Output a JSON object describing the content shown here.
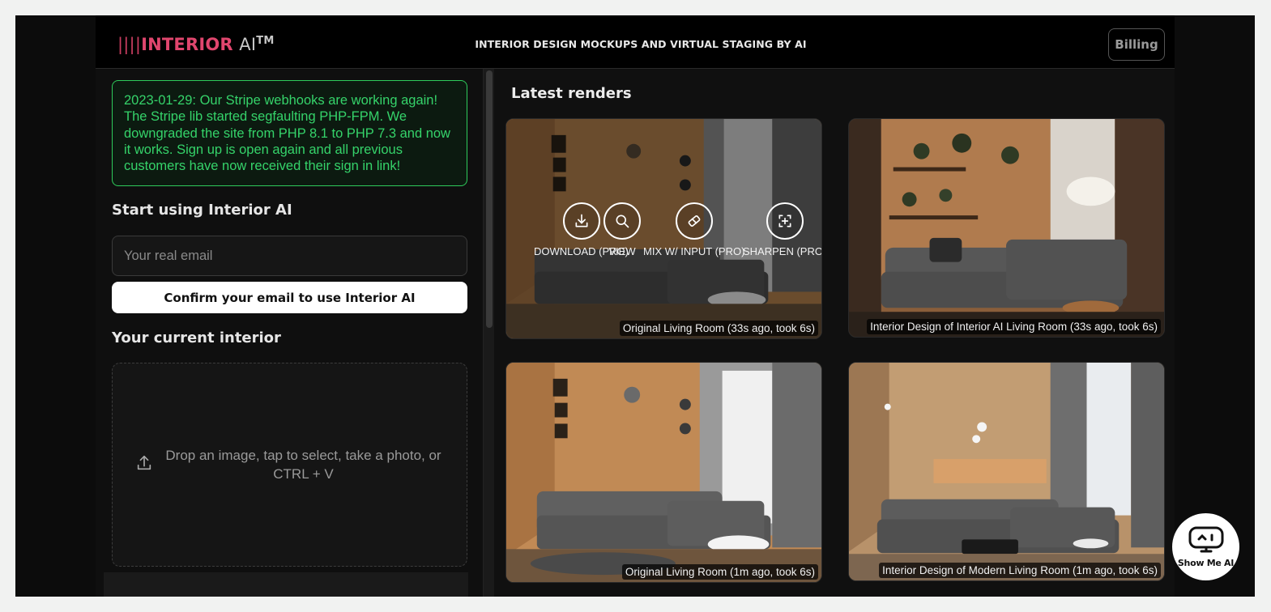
{
  "header": {
    "logo_bars": "||||",
    "logo_name": "INTERIOR",
    "logo_ai": "AI",
    "logo_tm": "TM",
    "tagline": "INTERIOR DESIGN MOCKUPS AND VIRTUAL STAGING BY AI",
    "billing_label": "Billing"
  },
  "sidebar": {
    "notice": "2023-01-29: Our Stripe webhooks are working again! The Stripe lib started segfaulting PHP-FPM. We downgraded the site from PHP 8.1 to PHP 7.3 and now it works. Sign up is open again and all previous customers have now received their sign in link!",
    "start_heading": "Start using Interior AI",
    "email_placeholder": "Your real email",
    "confirm_label": "Confirm your email to use Interior AI",
    "current_heading": "Your current interior",
    "dropzone_text": "Drop an image, tap to select, take a photo, or CTRL + V"
  },
  "main": {
    "latest_heading": "Latest renders",
    "actions": [
      {
        "label": "DOWNLOAD (PRO)",
        "icon": "download-icon"
      },
      {
        "label": "VIEW",
        "icon": "search-icon"
      },
      {
        "label": "MIX W/ INPUT (PRO)",
        "icon": "eraser-icon"
      },
      {
        "label": "SHARPEN (PRO)",
        "icon": "focus-icon"
      }
    ],
    "renders": [
      {
        "caption": "Original Living Room (33s ago, took 6s)"
      },
      {
        "caption": "Interior Design of Interior AI Living Room (33s ago, took 6s)"
      },
      {
        "caption": "Original Living Room (1m ago, took 6s)"
      },
      {
        "caption": "Interior Design of Modern Living Room (1m ago, took 6s)"
      }
    ]
  },
  "widget": {
    "label": "Show Me AI"
  },
  "colors": {
    "accent": "#e0466e",
    "notice_green": "#35d36a",
    "background": "#101010"
  }
}
